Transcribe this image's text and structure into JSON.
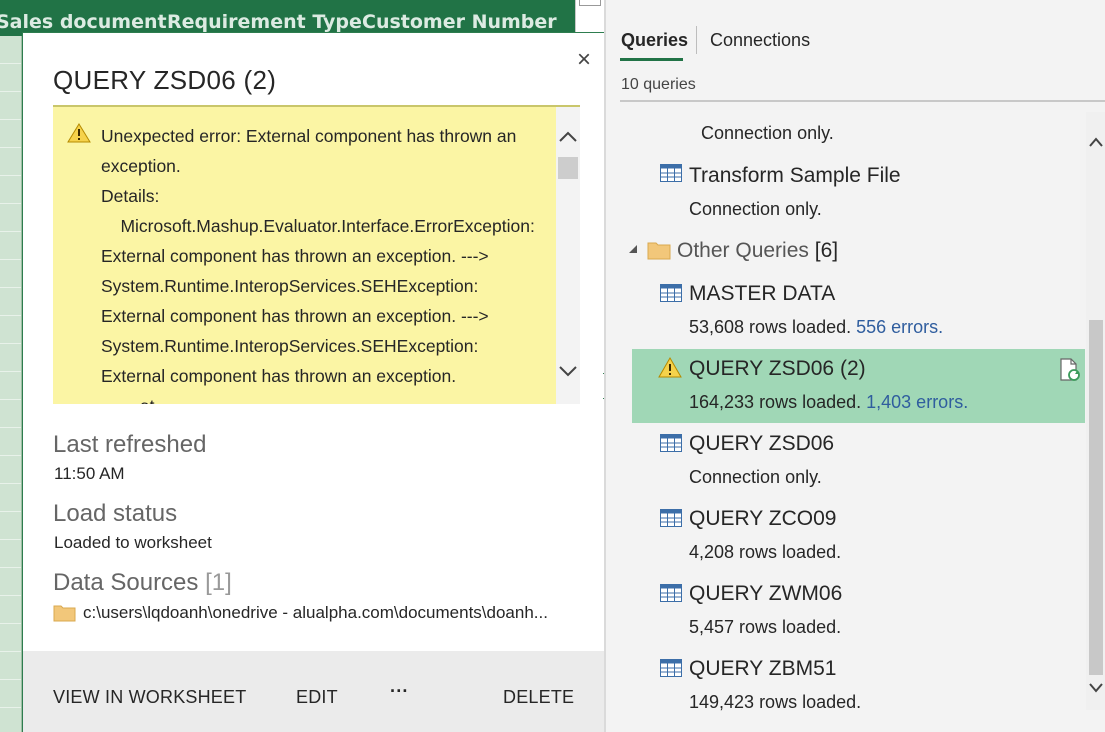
{
  "sheet": {
    "headers": [
      "Sales document",
      "Requirement Type",
      "Customer Number"
    ]
  },
  "card": {
    "title": "QUERY ZSD06 (2)",
    "close_glyph": "×",
    "error_text": "Unexpected error: External component has thrown an exception.\nDetails:\n    Microsoft.Mashup.Evaluator.Interface.ErrorException: External component has thrown an exception. ---> System.Runtime.InteropServices.SEHException: External component has thrown an exception. ---> System.Runtime.InteropServices.SEHException: External component has thrown an exception.\n        at",
    "last_refreshed_label": "Last refreshed",
    "last_refreshed_value": "11:50 AM",
    "load_status_label": "Load status",
    "load_status_value": "Loaded to worksheet",
    "data_sources_label": "Data Sources",
    "data_sources_count": "[1]",
    "data_source_path": "c:\\users\\lqdoanh\\onedrive - alualpha.com\\documents\\doanh...",
    "actions": {
      "view": "VIEW IN WORKSHEET",
      "edit": "EDIT",
      "more": "···",
      "delete": "DELETE"
    }
  },
  "pane": {
    "tabs": {
      "queries": "Queries",
      "connections": "Connections"
    },
    "query_count": "10 queries",
    "items": [
      {
        "name": "",
        "status": "Connection only.",
        "errors": ""
      },
      {
        "name": "Transform Sample File",
        "status": "Connection only.",
        "errors": ""
      },
      {
        "name": "MASTER DATA",
        "status": "53,608 rows loaded.",
        "errors": "556 errors."
      },
      {
        "name": "QUERY ZSD06 (2)",
        "status": "164,233 rows loaded.",
        "errors": "1,403 errors."
      },
      {
        "name": "QUERY ZSD06",
        "status": "Connection only.",
        "errors": ""
      },
      {
        "name": "QUERY ZCO09",
        "status": "4,208 rows loaded.",
        "errors": ""
      },
      {
        "name": "QUERY ZWM06",
        "status": "5,457 rows loaded.",
        "errors": ""
      },
      {
        "name": "QUERY ZBM51",
        "status": "149,423 rows loaded.",
        "errors": ""
      }
    ],
    "group": {
      "name": "Other Queries",
      "count": "[6]"
    }
  },
  "colors": {
    "excel_green": "#217346",
    "selected_row": "#a0d7b6",
    "error_bg": "#fbf5a4",
    "error_link": "#2f5d9e"
  }
}
